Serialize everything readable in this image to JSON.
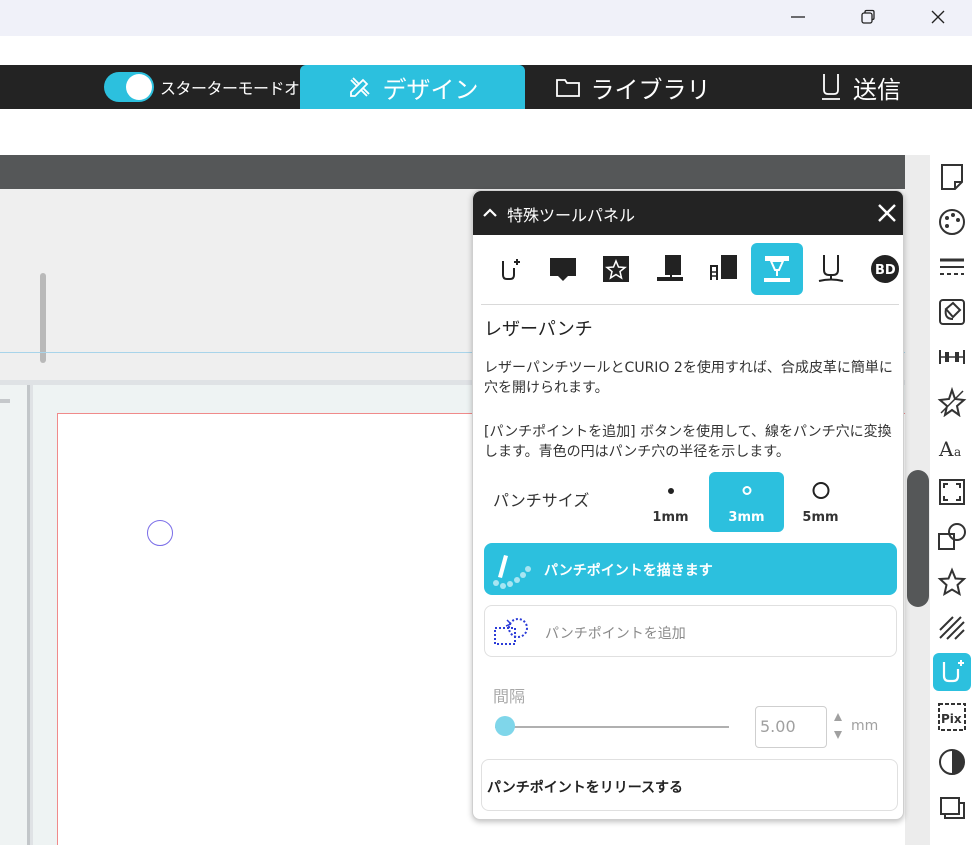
{
  "nav": {
    "starter_mode_label": "スターターモードオフ",
    "tabs": [
      {
        "label": "デザイン",
        "icon": "design-icon"
      },
      {
        "label": "ライブラリ",
        "icon": "folder-icon"
      },
      {
        "label": "送信",
        "icon": "send-icon"
      }
    ]
  },
  "panel": {
    "title": "特殊ツールパネル",
    "tool_title": "レザーパンチ",
    "description1": "レザーパンチツールとCURIO 2を使用すれば、合成皮革に簡単に穴を開けられます。",
    "description2": "[パンチポイントを追加] ボタンを使用して、線をパンチ穴に変換します。青色の円はパンチ穴の半径を示します。",
    "punch_size_label": "パンチサイズ",
    "sizes": [
      {
        "label": "1mm"
      },
      {
        "label": "3mm"
      },
      {
        "label": "5mm"
      }
    ],
    "selected_size": "3mm",
    "draw_button": "パンチポイントを描きます",
    "add_button": "パンチポイントを追加",
    "interval_label": "間隔",
    "interval_value": "5.00",
    "interval_unit": "mm",
    "release_button": "パンチポイントをリリースする"
  },
  "colors": {
    "accent": "#2cc0de",
    "nav_bg": "#232323",
    "canvas_border": "#f08a8a",
    "marker": "#7a6de8"
  }
}
